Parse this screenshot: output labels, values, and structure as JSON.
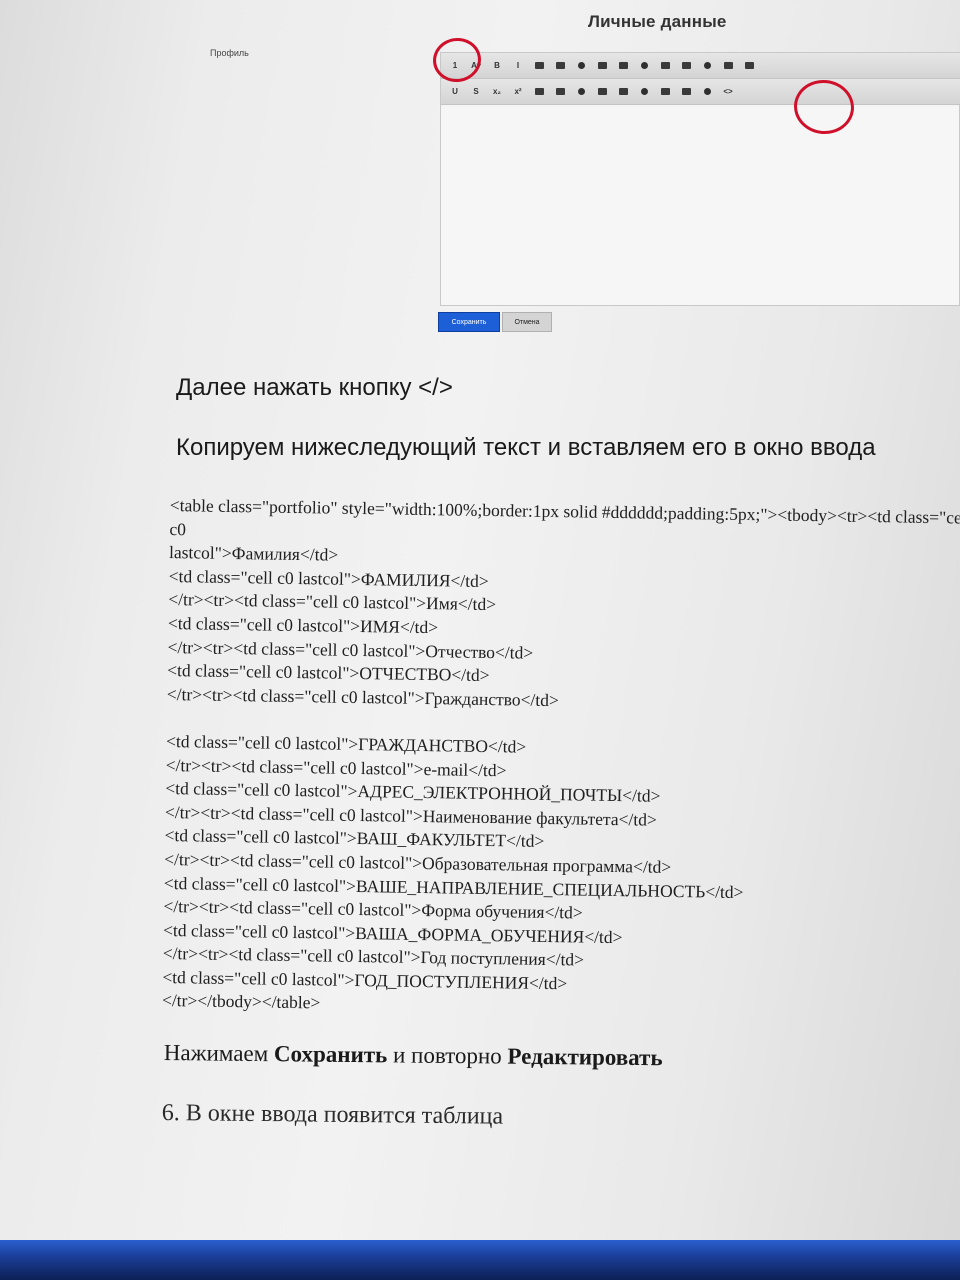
{
  "form": {
    "title": "Личные данные",
    "profile_label": "Профиль",
    "toolbar_row1": [
      "1",
      "A▾",
      "B",
      "I",
      "",
      "",
      "",
      "",
      "",
      "",
      "",
      "",
      "",
      "",
      ""
    ],
    "toolbar_row2": [
      "U",
      "S",
      "x₂",
      "x²",
      "",
      "",
      "",
      "",
      "",
      "",
      "",
      "",
      "",
      "<>"
    ],
    "save_label": "Сохранить",
    "cancel_label": "Отмена",
    "annotation_color": "#d0102a",
    "save_color": "#1d5fd6"
  },
  "doc": {
    "heading1": "Далее нажать кнопку </>",
    "heading2": "Копируем нижеследующий текст и вставляем его в окно ввода",
    "code_lines": [
      "<table class=\"portfolio\" style=\"width:100%;border:1px solid #dddddd;padding:5px;\"><tbody><tr><td class=\"cell",
      "c0",
      "lastcol\">Фамилия</td>",
      "<td class=\"cell c0 lastcol\">ФАМИЛИЯ</td>",
      "</tr><tr><td class=\"cell c0 lastcol\">Имя</td>",
      "<td class=\"cell c0 lastcol\">ИМЯ</td>",
      "</tr><tr><td class=\"cell c0 lastcol\">Отчество</td>",
      "<td class=\"cell c0 lastcol\">ОТЧЕСТВО</td>",
      "</tr><tr><td class=\"cell c0 lastcol\">Гражданство</td>",
      "",
      "<td class=\"cell c0 lastcol\">ГРАЖДАНСТВО</td>",
      "</tr><tr><td class=\"cell c0 lastcol\">e-mail</td>",
      "<td class=\"cell c0 lastcol\">АДРЕС_ЭЛЕКТРОННОЙ_ПОЧТЫ</td>",
      "</tr><tr><td class=\"cell c0 lastcol\">Наименование факультета</td>",
      "<td class=\"cell c0 lastcol\">ВАШ_ФАКУЛЬТЕТ</td>",
      "</tr><tr><td class=\"cell c0 lastcol\">Образовательная программа</td>",
      "<td class=\"cell c0 lastcol\">ВАШЕ_НАПРАВЛЕНИЕ_СПЕЦИАЛЬНОСТЬ</td>",
      "</tr><tr><td class=\"cell c0 lastcol\">Форма обучения</td>",
      "<td class=\"cell c0 lastcol\">ВАША_ФОРМА_ОБУЧЕНИЯ</td>",
      "</tr><tr><td class=\"cell c0 lastcol\">Год поступления</td>",
      "<td class=\"cell c0 lastcol\">ГОД_ПОСТУПЛЕНИЯ</td>",
      "</tr></tbody></table>"
    ],
    "step_prefix": "Нажимаем ",
    "step_save": "Сохранить",
    "step_middle": " и повторно ",
    "step_edit": "Редактировать",
    "step6": "6. В окне ввода появится таблица"
  }
}
